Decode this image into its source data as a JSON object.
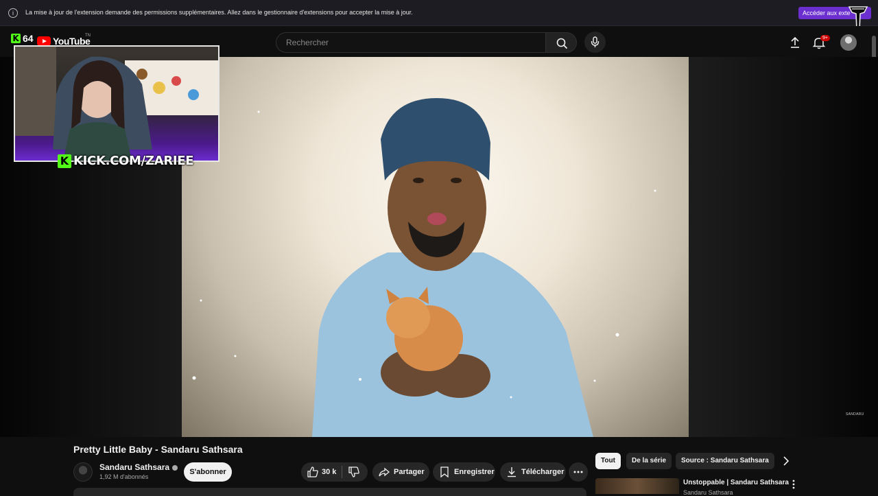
{
  "notification": {
    "message": "La mise à jour de l'extension demande des permissions supplémentaires. Allez dans le gestionnaire d'extensions pour accepter la mise à jour.",
    "accept_label": "Accéder aux exte"
  },
  "kick_viewers": "64",
  "kick_k": "K",
  "logo": {
    "name": "YouTube",
    "tm": "TN"
  },
  "search": {
    "placeholder": "Rechercher"
  },
  "notifications_badge": "9+",
  "video": {
    "watermark": "SANDARU"
  },
  "webcam": {
    "k": "K",
    "label": "KICK.COM/ZARIEE"
  },
  "video_title": "Pretty Little Baby - Sandaru Sathsara",
  "channel": {
    "name": "Sandaru Sathsara",
    "subscribers": "1,92 M d'abonnés"
  },
  "subscribe_label": "S'abonner",
  "actions": {
    "likes": "30 k",
    "share": "Partager",
    "save": "Enregistrer",
    "download": "Télécharger"
  },
  "chips": [
    {
      "label": "Tout",
      "active": true
    },
    {
      "label": "De la série",
      "active": false
    },
    {
      "label": "Source : Sandaru Sathsara",
      "active": false
    }
  ],
  "recommended": {
    "title": "Unstoppable | Sandaru Sathsara",
    "channel": "Sandaru Sathsara"
  },
  "colors": {
    "kick_green": "#53fc18",
    "youtube_red": "#ff0000",
    "accent_purple": "#6b2fcf"
  }
}
